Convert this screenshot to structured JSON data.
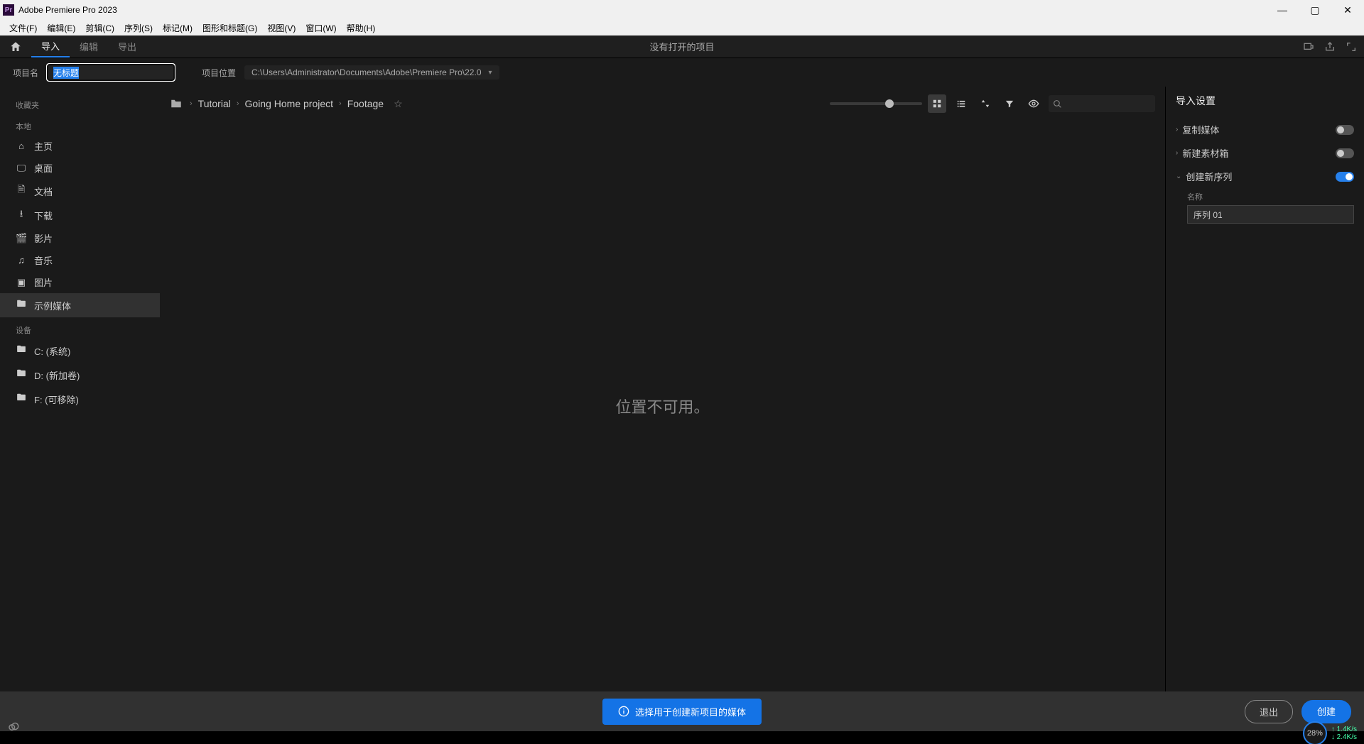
{
  "titlebar": {
    "appName": "Adobe Premiere Pro 2023"
  },
  "menubar": [
    "文件(F)",
    "编辑(E)",
    "剪辑(C)",
    "序列(S)",
    "标记(M)",
    "图形和标题(G)",
    "视图(V)",
    "窗口(W)",
    "帮助(H)"
  ],
  "appTabs": {
    "items": [
      "导入",
      "编辑",
      "导出"
    ],
    "activeIndex": 0,
    "centerTitle": "没有打开的项目"
  },
  "projectRow": {
    "nameLabel": "项目名",
    "nameValue": "无标题",
    "locationLabel": "项目位置",
    "path": "C:\\Users\\Administrator\\Documents\\Adobe\\Premiere Pro\\22.0"
  },
  "sidebar": {
    "favorites": "收藏夹",
    "local": "本地",
    "localItems": [
      {
        "icon": "home",
        "label": "主页"
      },
      {
        "icon": "desktop",
        "label": "桌面"
      },
      {
        "icon": "doc",
        "label": "文档"
      },
      {
        "icon": "download",
        "label": "下载"
      },
      {
        "icon": "video",
        "label": "影片"
      },
      {
        "icon": "music",
        "label": "音乐"
      },
      {
        "icon": "image",
        "label": "图片"
      },
      {
        "icon": "folder",
        "label": "示例媒体"
      }
    ],
    "devices": "设备",
    "deviceItems": [
      {
        "icon": "folder",
        "label": "C: (系统)"
      },
      {
        "icon": "folder",
        "label": "D: (新加卷)"
      },
      {
        "icon": "folder",
        "label": "F: (可移除)"
      }
    ],
    "activeLocalIndex": 7
  },
  "breadcrumb": [
    "Tutorial",
    "Going Home project",
    "Footage"
  ],
  "browser": {
    "emptyText": "位置不可用。"
  },
  "rightPanel": {
    "title": "导入设置",
    "copyMedia": "复制媒体",
    "newBin": "新建素材箱",
    "createSequence": "创建新序列",
    "seqNameLabel": "名称",
    "seqNameValue": "序列 01"
  },
  "footer": {
    "banner": "选择用于创建新项目的媒体",
    "exit": "退出",
    "create": "创建"
  },
  "network": {
    "percent": "28%",
    "up": "1.4K/s",
    "down": "2.4K/s"
  }
}
